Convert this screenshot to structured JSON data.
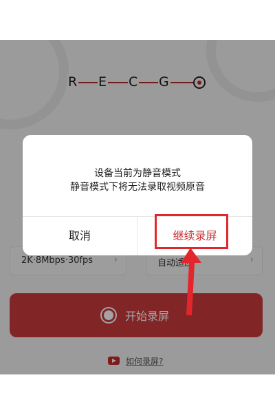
{
  "app": {
    "logo_letters": [
      "R",
      "E",
      "C",
      "G"
    ],
    "accent_color": "#cc3a3d"
  },
  "options": {
    "quality_value": "2K·8Mbps·30fps",
    "orientation_value": "自动适应",
    "chevron": "›"
  },
  "start_button": {
    "label": "开始录屏"
  },
  "help": {
    "label": "如何录屏?"
  },
  "dialog": {
    "message_line1": "设备当前为静音模式",
    "message_line2": "静音模式下将无法录取视频原音",
    "cancel_label": "取消",
    "continue_label": "继续录屏"
  }
}
